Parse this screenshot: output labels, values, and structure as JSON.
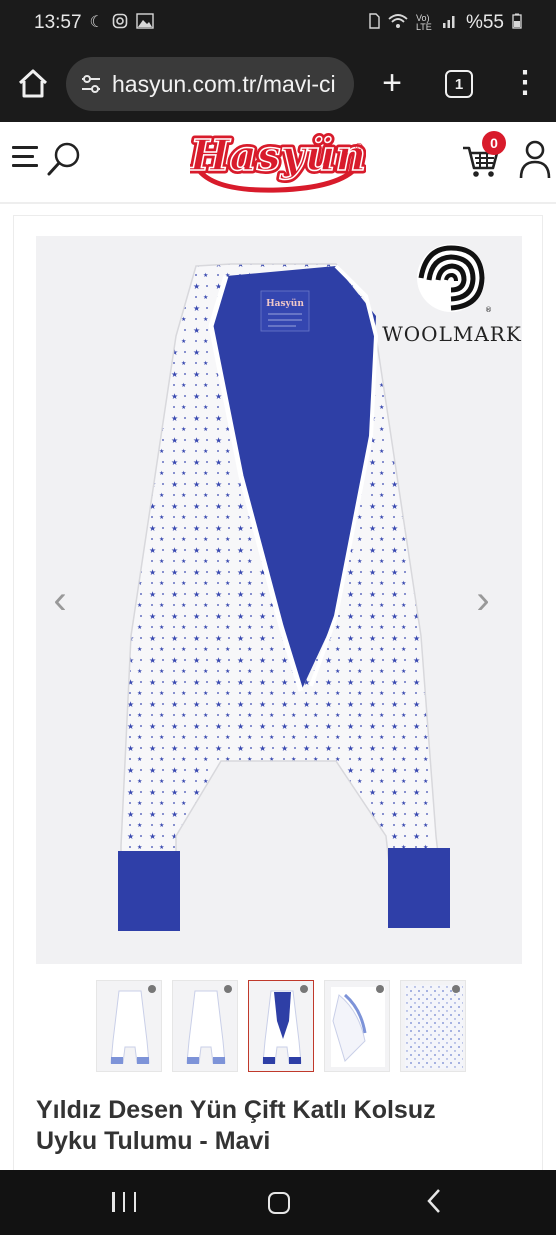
{
  "status_bar": {
    "time": "13:57",
    "battery": "%55",
    "icons": [
      "moon-icon",
      "instagram-icon",
      "image-icon",
      "sim-icon",
      "wifi-icon",
      "volte-icon",
      "signal-icon",
      "battery-icon"
    ],
    "volte_label": "Vo) LTE"
  },
  "browser": {
    "url": "hasyun.com.tr/mavi-ci",
    "tab_count": "1",
    "plus_label": "+",
    "menu_label": "⋮"
  },
  "header": {
    "logo_text": "Hasyün",
    "logo_registered": "®",
    "cart_count": "0",
    "brand_color": "#d81b2b"
  },
  "product": {
    "image_watermark": "WOOLMARK",
    "label_brand": "Hasyün",
    "thumbnails": [
      {
        "label": "thumbnail-1",
        "active": false
      },
      {
        "label": "thumbnail-2",
        "active": false
      },
      {
        "label": "thumbnail-3",
        "active": true
      },
      {
        "label": "thumbnail-4",
        "active": false
      },
      {
        "label": "thumbnail-5",
        "active": false
      }
    ],
    "title_line1": "Yıldız Desen Yün Çift Katlı Kolsuz",
    "title_line2": "Uyku Tulumu - Mavi"
  },
  "arrows": {
    "prev": "‹",
    "next": "›"
  },
  "colors": {
    "accent_red": "#d81b2b",
    "fabric_blue": "#2e3fa6",
    "header_dark": "#1b1b1b"
  }
}
